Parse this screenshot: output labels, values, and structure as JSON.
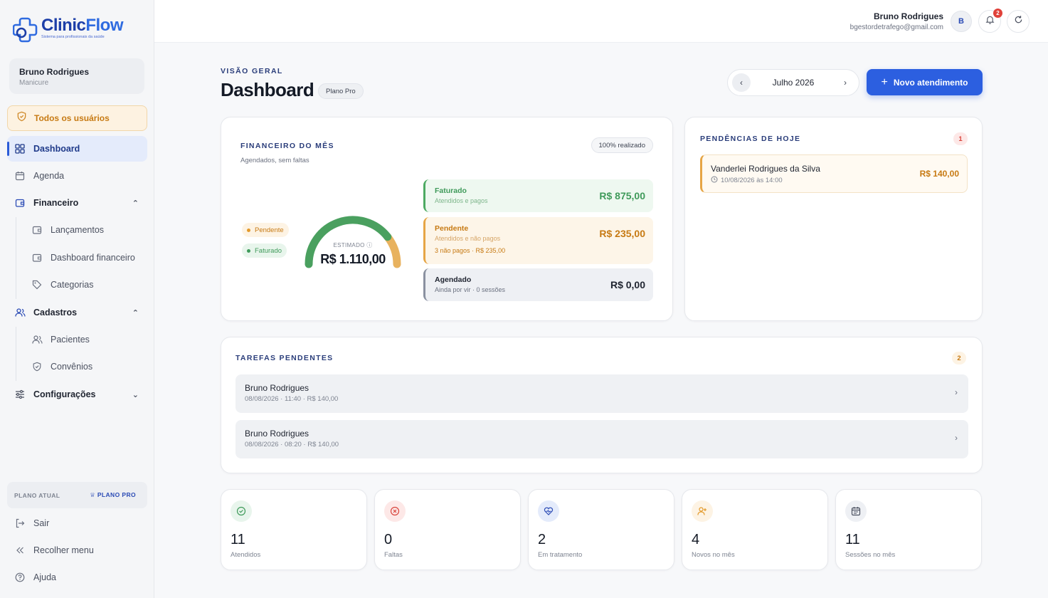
{
  "brand": {
    "name_a": "Clinic",
    "name_b": "Flow",
    "tagline": "Sistema para profissionais da saúde"
  },
  "sidebar": {
    "user": {
      "name": "Bruno Rodrigues",
      "role": "Manicure"
    },
    "all_users": "Todos os usuários",
    "items": {
      "dashboard": "Dashboard",
      "agenda": "Agenda",
      "financeiro": "Financeiro",
      "lancamentos": "Lançamentos",
      "dash_fin": "Dashboard financeiro",
      "categorias": "Categorias",
      "cadastros": "Cadastros",
      "pacientes": "Pacientes",
      "convenios": "Convênios",
      "config": "Configurações"
    },
    "plan_label": "PLANO ATUAL",
    "plan_value": "PLANO PRO",
    "sair": "Sair",
    "recolher": "Recolher menu",
    "ajuda": "Ajuda"
  },
  "topbar": {
    "user_name": "Bruno Rodrigues",
    "user_email": "bgestordetrafego@gmail.com",
    "avatar": "B",
    "notifications": "2"
  },
  "header": {
    "overline": "VISÃO GERAL",
    "title": "Dashboard",
    "plan": "Plano Pro",
    "month": "Julho 2026",
    "new_button": "Novo atendimento"
  },
  "financeiro": {
    "title": "FINANCEIRO DO MÊS",
    "subtitle": "Agendados, sem faltas",
    "realizado": "100% realizado",
    "legend_pendente": "Pendente",
    "legend_faturado": "Faturado",
    "gauge_label": "ESTIMADO",
    "gauge_value": "R$ 1.110,00",
    "gauge_fraction_faturado": 0.788,
    "faturado": {
      "title": "Faturado",
      "sub": "Atendidos e pagos",
      "value": "R$ 875,00"
    },
    "pendente": {
      "title": "Pendente",
      "sub": "Atendidos e não pagos",
      "sub2": "3 não pagos · R$ 235,00",
      "value": "R$ 235,00"
    },
    "agendado": {
      "title": "Agendado",
      "sub": "Ainda por vir · 0 sessões",
      "value": "R$ 0,00"
    }
  },
  "pendencias": {
    "title": "PENDÊNCIAS DE HOJE",
    "count": "1",
    "item": {
      "name": "Vanderlei Rodrigues da Silva",
      "date": "10/08/2026 às 14:00",
      "value": "R$ 140,00"
    }
  },
  "tarefas": {
    "title": "TAREFAS PENDENTES",
    "count": "2",
    "items": [
      {
        "name": "Bruno Rodrigues",
        "detail": "08/08/2026 · 11:40 · R$ 140,00"
      },
      {
        "name": "Bruno Rodrigues",
        "detail": "08/08/2026 · 08:20 · R$ 140,00"
      }
    ]
  },
  "stats": [
    {
      "value": "11",
      "label": "Atendidos",
      "icon": "check-circle-icon",
      "color": "#3f9a5a",
      "bg": "#e8f5ec"
    },
    {
      "value": "0",
      "label": "Faltas",
      "icon": "x-circle-icon",
      "color": "#d9453d",
      "bg": "#fde8e7"
    },
    {
      "value": "2",
      "label": "Em tratamento",
      "icon": "heart-pulse-icon",
      "color": "#2b4bb5",
      "bg": "#e4ebfb"
    },
    {
      "value": "4",
      "label": "Novos no mês",
      "icon": "user-plus-icon",
      "color": "#e39a2c",
      "bg": "#fdf3e4"
    },
    {
      "value": "11",
      "label": "Sessões no mês",
      "icon": "calendar-icon",
      "color": "#4b5160",
      "bg": "#eef0f4"
    }
  ]
}
